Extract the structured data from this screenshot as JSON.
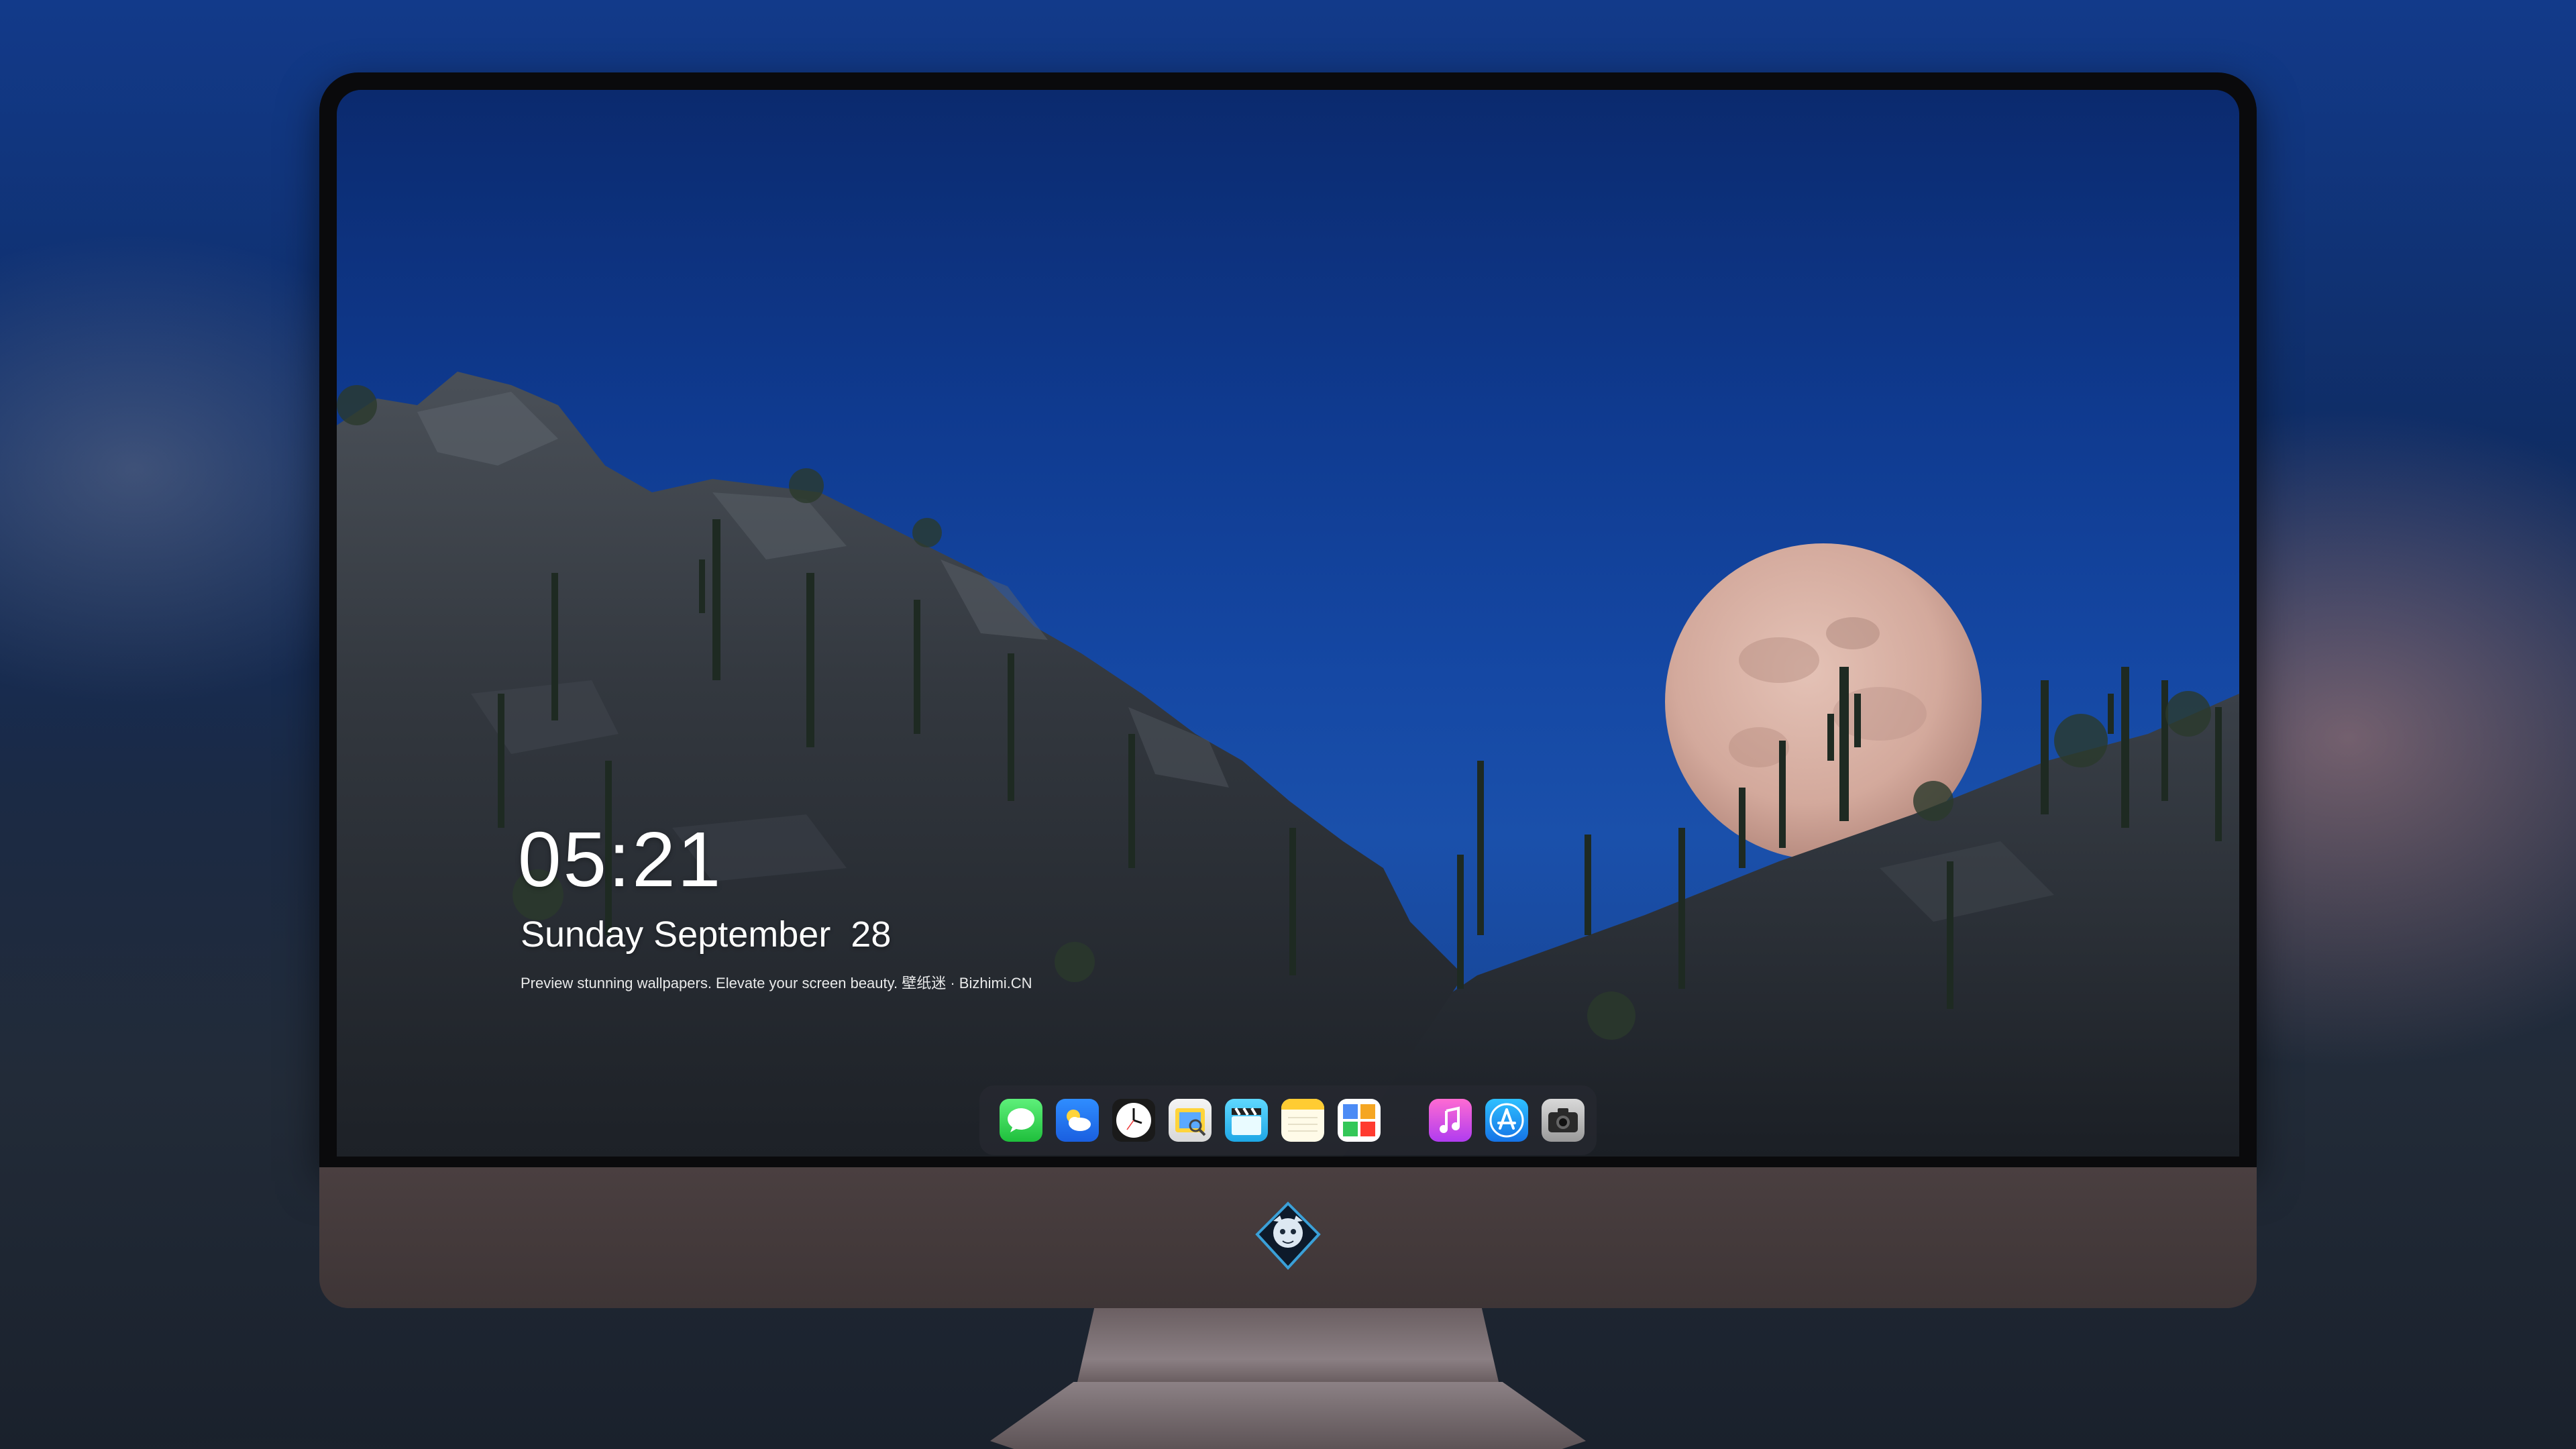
{
  "lockscreen": {
    "time": "05:21",
    "date": "Sunday September  28",
    "tagline": "Preview stunning wallpapers. Elevate your screen beauty. 壁纸迷 · Bizhimi.CN"
  },
  "dock": {
    "apps": [
      {
        "name": "messages-icon"
      },
      {
        "name": "weather-icon"
      },
      {
        "name": "clock-icon"
      },
      {
        "name": "preview-icon"
      },
      {
        "name": "clips-icon"
      },
      {
        "name": "notes-icon"
      },
      {
        "name": "photo-grid-icon"
      },
      {
        "name": "music-icon"
      },
      {
        "name": "app-store-icon"
      },
      {
        "name": "camera-icon"
      }
    ]
  },
  "colors": {
    "sky_top": "#0b2a6e",
    "sky_mid": "#1548a4",
    "moon": "#d8b2a6",
    "hill": "#2b3038",
    "chin": "#4a3f40"
  }
}
